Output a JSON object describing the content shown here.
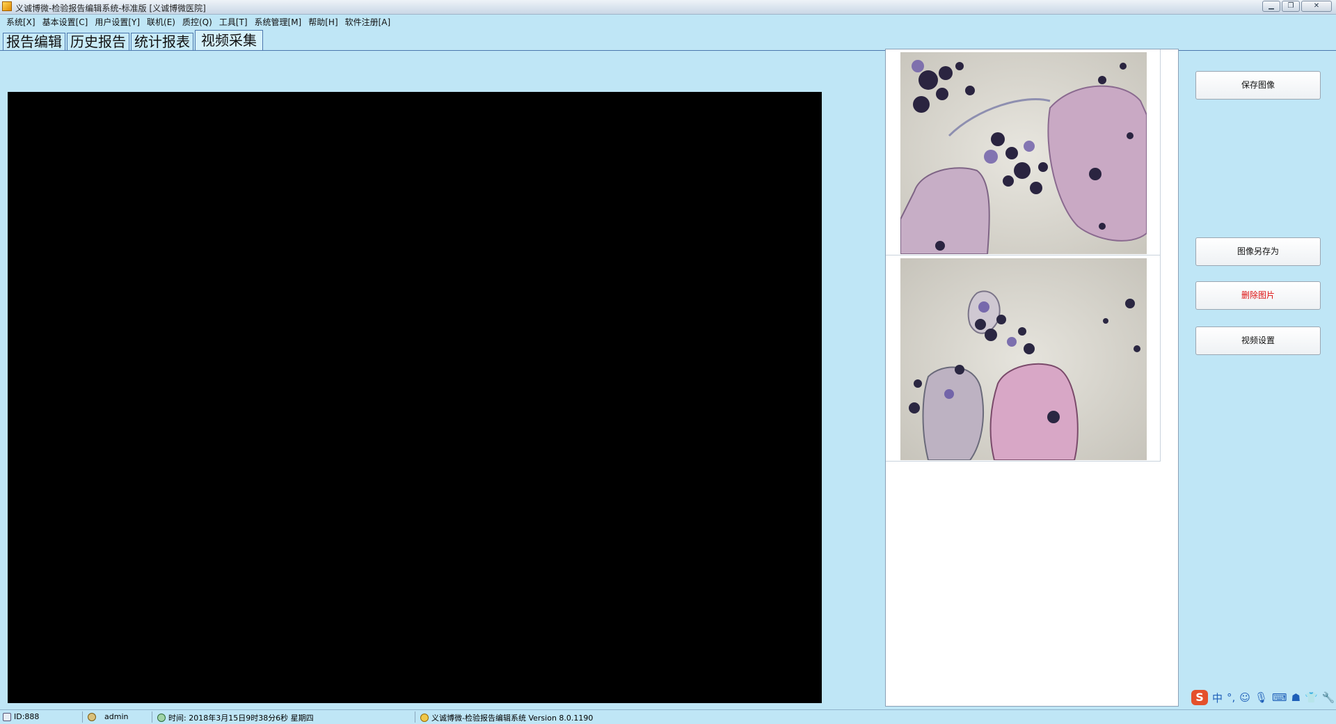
{
  "window": {
    "title": "义诚博微-检验报告编辑系统-标准版  [义诚博微医院]"
  },
  "menu": [
    "系统[X]",
    "基本设置[C]",
    "用户设置[Y]",
    "联机(E)",
    "质控(Q)",
    "工具[T]",
    "系统管理[M]",
    "帮助[H]",
    "软件注册[A]"
  ],
  "tabs": [
    {
      "label": "报告编辑"
    },
    {
      "label": "历史报告"
    },
    {
      "label": "统计报表"
    },
    {
      "label": "视频采集"
    }
  ],
  "buttons": {
    "save_image": "保存图像",
    "save_image_as": "图像另存为",
    "delete_image": "删除图片",
    "video_settings": "视频设置"
  },
  "status": {
    "id": "ID:888",
    "user": "admin",
    "time": "时间: 2018年3月15日9时38分6秒  星期四",
    "app": "义诚博微-检验报告编辑系统 Version 8.0.1190"
  },
  "tray": {
    "lang": "中",
    "punct": "°,"
  },
  "colors": {
    "background": "#bfe6f6",
    "tab_border": "#4b77ad",
    "delete_text": "#dd1111"
  }
}
